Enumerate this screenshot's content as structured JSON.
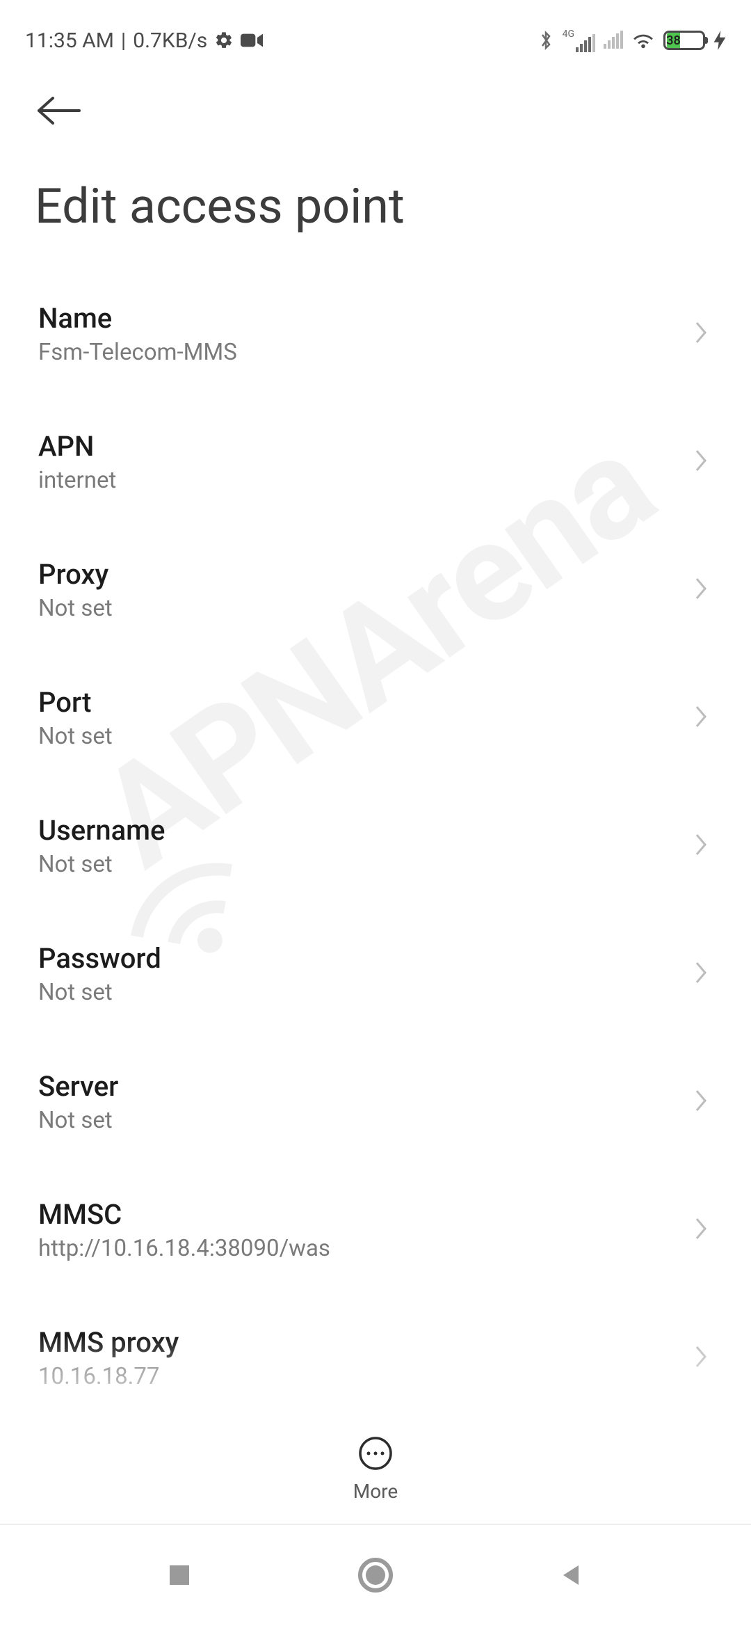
{
  "status_bar": {
    "time": "11:35 AM",
    "data_rate": "0.7KB/s",
    "network_label": "4G",
    "battery_percent": "38"
  },
  "page": {
    "title": "Edit access point"
  },
  "apn_fields": [
    {
      "label": "Name",
      "value": "Fsm-Telecom-MMS"
    },
    {
      "label": "APN",
      "value": "internet"
    },
    {
      "label": "Proxy",
      "value": "Not set"
    },
    {
      "label": "Port",
      "value": "Not set"
    },
    {
      "label": "Username",
      "value": "Not set"
    },
    {
      "label": "Password",
      "value": "Not set"
    },
    {
      "label": "Server",
      "value": "Not set"
    },
    {
      "label": "MMSC",
      "value": "http://10.16.18.4:38090/was"
    },
    {
      "label": "MMS proxy",
      "value": "10.16.18.77"
    }
  ],
  "more_button": {
    "label": "More"
  },
  "watermark_text": "APNArena"
}
